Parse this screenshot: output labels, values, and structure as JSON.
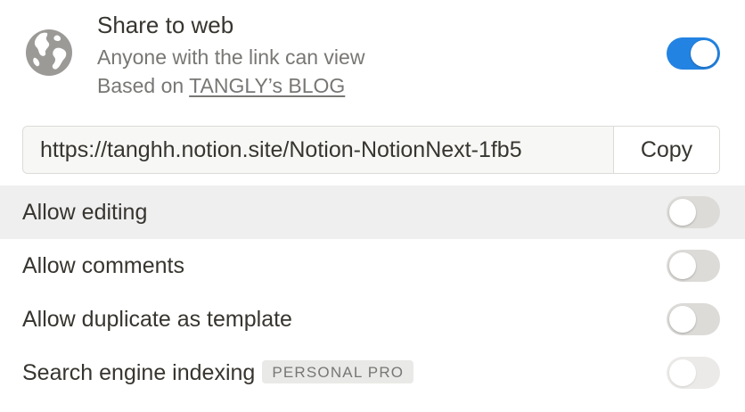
{
  "share": {
    "title": "Share to web",
    "subtitle": "Anyone with the link can view",
    "based_prefix": "Based on ",
    "based_link": "TANGLY’s BLOG",
    "enabled": true,
    "globe_icon": "globe-icon"
  },
  "link": {
    "url": "https://tanghh.notion.site/Notion-NotionNext-1fb5",
    "copy_label": "Copy"
  },
  "options": [
    {
      "label": "Allow editing",
      "enabled": false,
      "hovered": true
    },
    {
      "label": "Allow comments",
      "enabled": false
    },
    {
      "label": "Allow duplicate as template",
      "enabled": false
    },
    {
      "label": "Search engine indexing",
      "enabled": false,
      "disabled": true,
      "badge": "PERSONAL PRO"
    }
  ],
  "colors": {
    "accent": "#2383e2",
    "toggle_off": "#dcdbd8",
    "hover_row": "#efefef",
    "text": "#37352f",
    "muted": "#787774"
  }
}
